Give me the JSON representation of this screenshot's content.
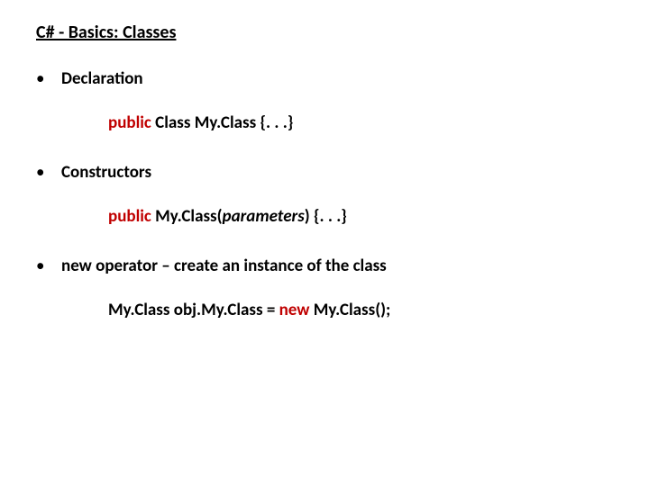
{
  "title": "C# - Basics: Classes",
  "bullets": {
    "b1": "Declaration",
    "b2": "Constructors",
    "b3_pre": "new",
    "b3_post": " operator – create an instance of the class"
  },
  "code": {
    "decl_kw": "public",
    "decl_rest": "  Class  My.Class {. . .}",
    "ctor_kw": "public",
    "ctor_pre": "  My.Class(",
    "ctor_param": "parameters",
    "ctor_post": ") {. . .}",
    "inst_lhs": "My.Class  obj.My.Class  =  ",
    "inst_kw": "new",
    "inst_rhs": " My.Class();"
  }
}
